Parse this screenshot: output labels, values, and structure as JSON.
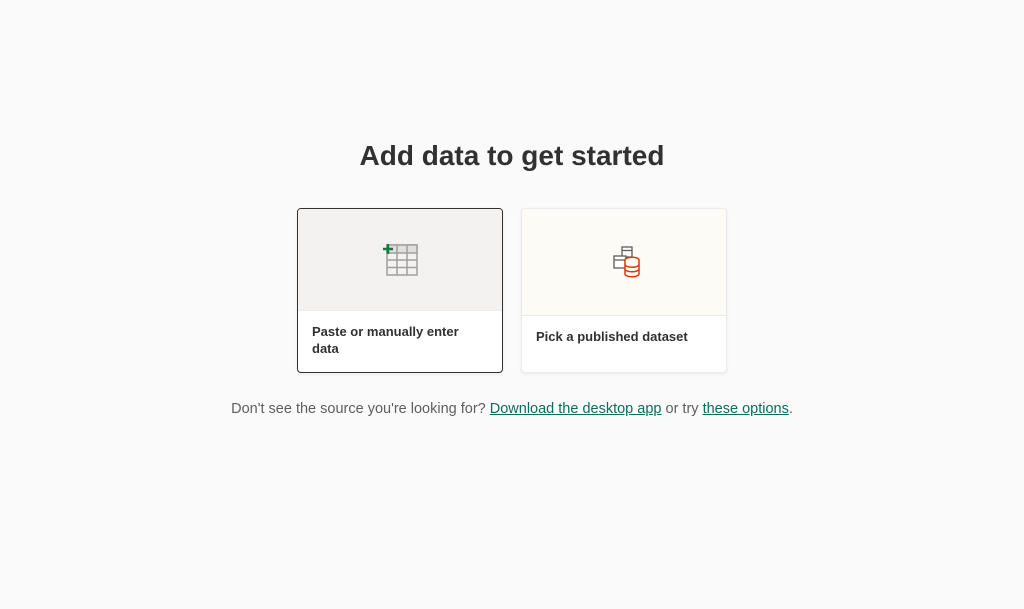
{
  "title": "Add data to get started",
  "cards": {
    "paste": {
      "label": "Paste or manually enter data"
    },
    "dataset": {
      "label": "Pick a published dataset"
    }
  },
  "helper": {
    "prefix": "Don't see the source you're looking for? ",
    "download_link": "Download the desktop app",
    "middle": " or try ",
    "options_link": "these options",
    "suffix": "."
  }
}
